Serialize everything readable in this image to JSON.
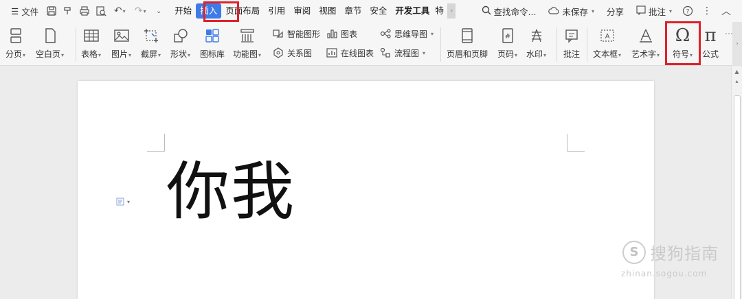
{
  "menubar": {
    "menu_label": "文件",
    "tabs": [
      "开始",
      "插入",
      "页面布局",
      "引用",
      "审阅",
      "视图",
      "章节",
      "安全",
      "开发工具",
      "特"
    ],
    "search_label": "查找命令...",
    "save_status": "未保存",
    "share": "分享",
    "comment": "批注"
  },
  "ribbon": {
    "page_break": "分页",
    "blank_page": "空白页",
    "table": "表格",
    "picture": "图片",
    "screenshot": "截屏",
    "shape": "形状",
    "icon_lib": "图标库",
    "function_chart": "功能图",
    "smart_shape": "智能图形",
    "chart": "图表",
    "mind_map": "思维导图",
    "relation_chart": "关系图",
    "online_chart": "在线图表",
    "flowchart": "流程图",
    "header_footer": "页眉和页脚",
    "page_number": "页码",
    "watermark": "水印",
    "comment": "批注",
    "text_box": "文本框",
    "art_text": "艺术字",
    "symbol": "符号",
    "formula": "公式"
  },
  "document": {
    "text": "你我"
  },
  "watermark": {
    "brand": "搜狗指南",
    "url": "zhinan.sogou.com"
  },
  "colors": {
    "accent": "#3e7be8",
    "highlight": "#e0202a"
  }
}
